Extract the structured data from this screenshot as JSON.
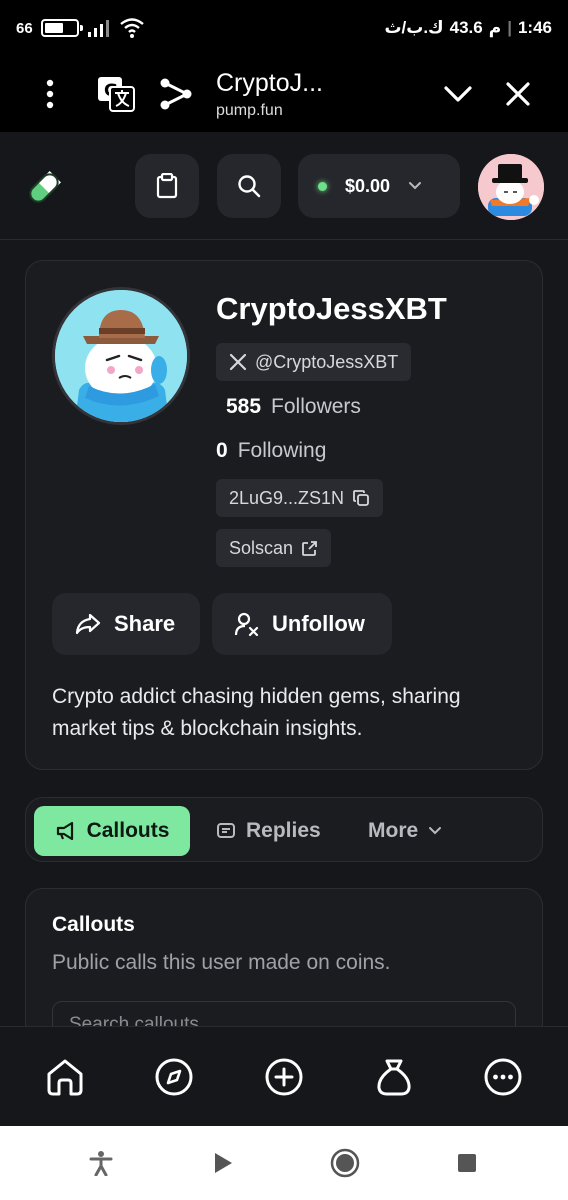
{
  "status_bar": {
    "time": "1:46",
    "am_pm": "م",
    "speed": "43.6",
    "speed_unit": "ك.ب/ث",
    "battery": "66"
  },
  "browser": {
    "title": "CryptoJ...",
    "url": "pump.fun"
  },
  "header": {
    "wallet_balance": "$0.00"
  },
  "profile": {
    "name": "CryptoJessXBT",
    "x_handle": "@CryptoJessXBT",
    "followers_count": "585",
    "followers_label": "Followers",
    "following_count": "0",
    "following_label": "Following",
    "address": "2LuG9...ZS1N",
    "solscan_label": "Solscan",
    "share_label": "Share",
    "unfollow_label": "Unfollow",
    "bio": "Crypto addict chasing hidden gems, sharing market tips & blockchain insights."
  },
  "tabs": {
    "callouts": "Callouts",
    "replies": "Replies",
    "more": "More"
  },
  "callouts_section": {
    "title": "Callouts",
    "subtitle": "Public calls this user made on coins.",
    "search_placeholder": "Search callouts..."
  },
  "bottom_nav": [
    "home-icon",
    "compass-icon",
    "plus-circle-icon",
    "money-bag-icon",
    "more-circle-icon"
  ],
  "colors": {
    "accent_green": "#7ee7a0",
    "background": "#16171a",
    "card": "#1b1c20"
  }
}
